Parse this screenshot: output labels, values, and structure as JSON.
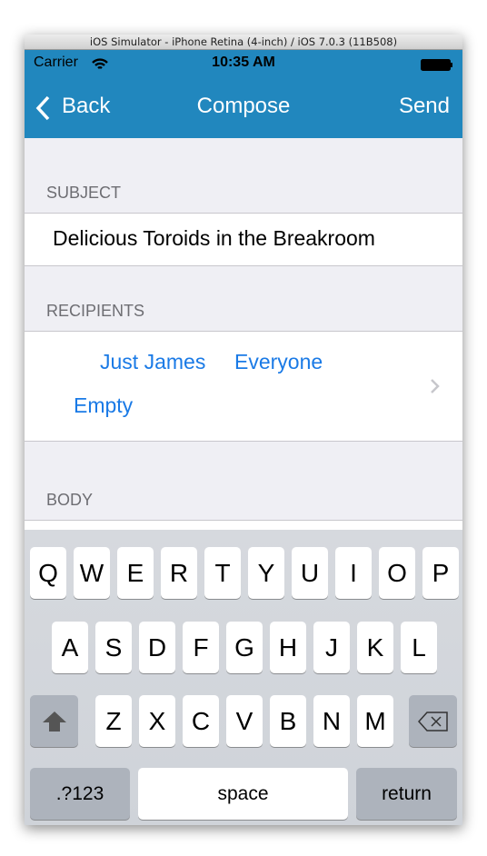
{
  "window_title": "iOS Simulator - iPhone Retina (4-inch) / iOS 7.0.3 (11B508)",
  "status": {
    "carrier": "Carrier",
    "time": "10:35 AM"
  },
  "nav": {
    "back": "Back",
    "title": "Compose",
    "send": "Send"
  },
  "subject": {
    "header": "SUBJECT",
    "value": "Delicious Toroids in the Breakroom"
  },
  "recipients": {
    "header": "RECIPIENTS",
    "options": [
      "Just James",
      "Everyone",
      "Empty"
    ]
  },
  "body": {
    "header": "BODY"
  },
  "keyboard": {
    "row1": [
      "Q",
      "W",
      "E",
      "R",
      "T",
      "Y",
      "U",
      "I",
      "O",
      "P"
    ],
    "row2": [
      "A",
      "S",
      "D",
      "F",
      "G",
      "H",
      "J",
      "K",
      "L"
    ],
    "row3": [
      "Z",
      "X",
      "C",
      "V",
      "B",
      "N",
      "M"
    ],
    "numbers": ".?123",
    "space": "space",
    "return": "return"
  },
  "colors": {
    "nav_bar": "#2187be",
    "link": "#1a7ae6",
    "background": "#efeff4"
  }
}
